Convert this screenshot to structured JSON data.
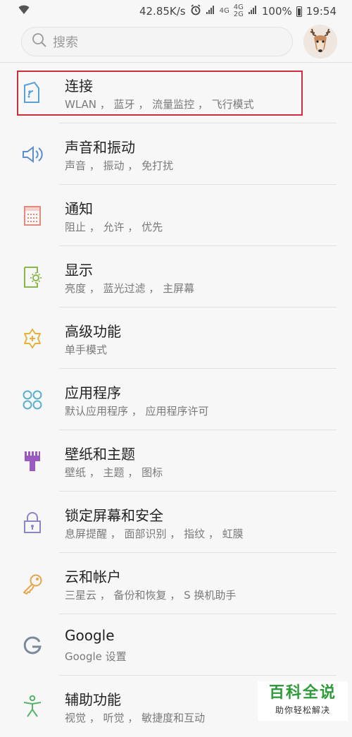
{
  "status_bar": {
    "network_speed": "42.85K/s",
    "net_label_1": "4G",
    "net_label_2a": "4G",
    "net_label_2b": "2G",
    "battery": "100%",
    "time": "19:54"
  },
  "search": {
    "placeholder": "搜索"
  },
  "settings": [
    {
      "title": "连接",
      "subtitle": "WLAN ， 蓝牙 ， 流量监控 ， 飞行模式",
      "icon": "connections-icon",
      "color": "#5aa0d8"
    },
    {
      "title": "声音和振动",
      "subtitle": "声音 ， 振动 ， 免打扰",
      "icon": "speaker-icon",
      "color": "#5a8fd0"
    },
    {
      "title": "通知",
      "subtitle": "阻止 ， 允许 ， 优先",
      "icon": "notification-icon",
      "color": "#e48a7a"
    },
    {
      "title": "显示",
      "subtitle": "亮度 ， 蓝光过滤 ， 主屏幕",
      "icon": "display-icon",
      "color": "#88b84a"
    },
    {
      "title": "高级功能",
      "subtitle": "单手模式",
      "icon": "advanced-features-icon",
      "color": "#e8b23a"
    },
    {
      "title": "应用程序",
      "subtitle": "默认应用程序 ， 应用程序许可",
      "icon": "apps-icon",
      "color": "#5ab0d0"
    },
    {
      "title": "壁纸和主题",
      "subtitle": "壁纸 ， 主题 ， 图标",
      "icon": "themes-icon",
      "color": "#9a5ac0"
    },
    {
      "title": "锁定屏幕和安全",
      "subtitle": "息屏提醒 ， 面部识别 ， 指纹 ， 虹膜",
      "icon": "lock-icon",
      "color": "#8a86c8"
    },
    {
      "title": "云和帐户",
      "subtitle": "三星云 ， 备份和恢复 ， S 换机助手",
      "icon": "key-icon",
      "color": "#e8a44a"
    },
    {
      "title": "Google",
      "subtitle": "Google 设置",
      "icon": "google-icon",
      "color": "#7a8a9a"
    },
    {
      "title": "辅助功能",
      "subtitle": "视觉 ， 听觉 ， 敏捷度和互动",
      "icon": "accessibility-icon",
      "color": "#58b46a"
    }
  ],
  "watermark": {
    "main": "百科全说",
    "sub": "助你轻松解决"
  },
  "highlight_color": "#cc2d3b"
}
